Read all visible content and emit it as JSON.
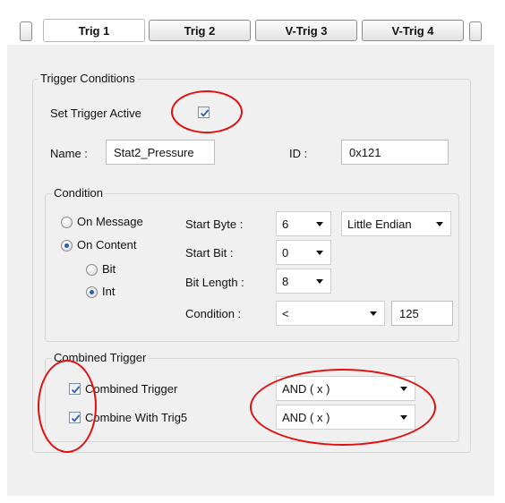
{
  "tabs": [
    {
      "label": "Trig 1",
      "active": true
    },
    {
      "label": "Trig 2",
      "active": false
    },
    {
      "label": "V-Trig 3",
      "active": false
    },
    {
      "label": "V-Trig 4",
      "active": false
    }
  ],
  "trigger_conditions": {
    "legend": "Trigger Conditions",
    "set_active_label": "Set Trigger Active",
    "set_active_checked": true,
    "name_label": "Name :",
    "name_value": "Stat2_Pressure",
    "id_label": "ID :",
    "id_value": "0x121"
  },
  "condition": {
    "legend": "Condition",
    "on_message_label": "On Message",
    "on_content_label": "On Content",
    "bit_label": "Bit",
    "int_label": "Int",
    "start_byte_label": "Start Byte :",
    "start_byte_value": "6",
    "endian_value": "Little Endian",
    "start_bit_label": "Start Bit :",
    "start_bit_value": "0",
    "bit_length_label": "Bit Length :",
    "bit_length_value": "8",
    "condition_label": "Condition :",
    "condition_op": "<",
    "condition_value": "125"
  },
  "combined": {
    "legend": "Combined Trigger",
    "combined_label": "Combined Trigger",
    "combined_checked": true,
    "combined_op": "AND ( x )",
    "combine_with_label": "Combine With Trig5",
    "combine_with_checked": true,
    "combine_with_op": "AND ( x )"
  },
  "colors": {
    "annotation": "#e01010",
    "radio_selected": "#2a5db0",
    "check": "#2a5db0"
  },
  "icons": {
    "dropdown": "chevron-down-icon",
    "check": "checkmark-icon"
  }
}
